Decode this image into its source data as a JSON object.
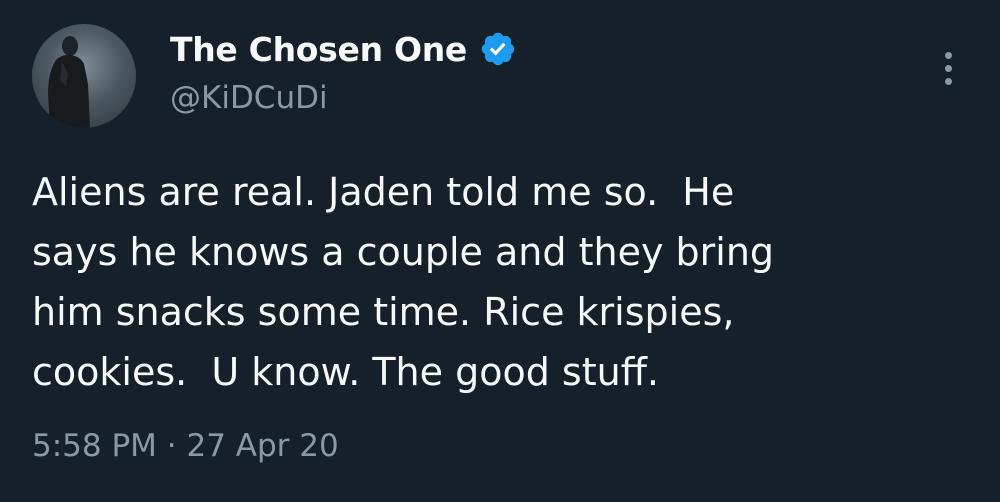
{
  "tweet": {
    "author": {
      "display_name": "The Chosen One",
      "handle": "@KiDCuDi",
      "verified": true,
      "avatar_icon": "profile-photo"
    },
    "text_lines": [
      "Aliens are real. Jaden told me so.  He",
      "says he knows a couple and they bring",
      "him snacks some time. Rice krispies,",
      "cookies.  U know. The good stuff."
    ],
    "timestamp": "5:58 PM · 27 Apr 20",
    "more_icon": "more-vertical-icon"
  },
  "colors": {
    "background": "#15202b",
    "text_primary": "#f7f9f9",
    "text_secondary": "#8b98a5",
    "verified_badge": "#1d9bf0"
  }
}
